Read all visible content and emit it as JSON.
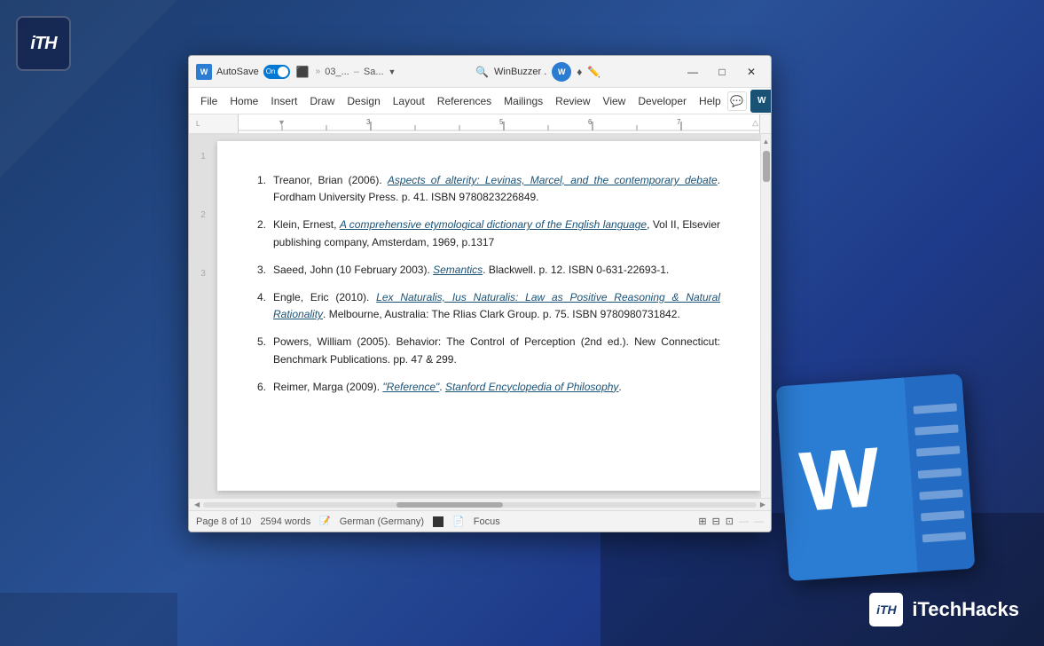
{
  "background": {
    "colors": {
      "primary": "#1a3a6b",
      "secondary": "#2a5298"
    }
  },
  "logo": {
    "letters": "iTH",
    "brand_name": "iTechHacks"
  },
  "titlebar": {
    "autosave_label": "AutoSave",
    "toggle_state": "On",
    "filename": "03_...",
    "separator": "–",
    "docname": "Sa...",
    "app_name": "WinBuzzer .",
    "search_placeholder": "Search"
  },
  "menubar": {
    "items": [
      "File",
      "Home",
      "Insert",
      "Draw",
      "Design",
      "Layout",
      "References",
      "Mailings",
      "Review",
      "View",
      "Developer",
      "Help"
    ]
  },
  "window_controls": {
    "minimize": "—",
    "maximize": "□",
    "close": "✕"
  },
  "references": [
    {
      "num": "1.",
      "text_before": "Treanor, Brian (2006).",
      "link_text": "Aspects of alterity: Levinas, Marcel, and the contemporary debate",
      "text_after": ". Fordham University Press. p. 41. ISBN 9780823226849."
    },
    {
      "num": "2.",
      "text_before": "Klein, Ernest,",
      "link_text": "A comprehensive etymological dictionary of the English language",
      "text_after": ", Vol II, Elsevier publishing company, Amsterdam, 1969, p.1317"
    },
    {
      "num": "3.",
      "text_before": "Saeed, John (10 February 2003).",
      "link_text": "Semantics",
      "text_after": ". Blackwell. p. 12. ISBN 0-631-22693-1."
    },
    {
      "num": "4.",
      "text_before": "Engle, Eric (2010).",
      "link_text": "Lex Naturalis, Ius Naturalis: Law as Positive Reasoning & Natural Rationality",
      "text_after": ". Melbourne, Australia: The Rlias Clark Group. p. 75. ISBN 9780980731842."
    },
    {
      "num": "5.",
      "text_before": "Powers, William (2005). Behavior: The Control of Perception (2nd ed.). New Connecticut: Benchmark Publications. pp. 47 & 299."
    },
    {
      "num": "6.",
      "text_before": "Reimer, Marga (2009).",
      "link_text": "\"Reference\"",
      "text_after": ".",
      "link2_text": "Stanford Encyclopedia of Philosophy",
      "text_after2": "."
    }
  ],
  "statusbar": {
    "page_info": "Page 8 of 10",
    "word_count": "2594 words",
    "language": "German (Germany)",
    "focus": "Focus"
  },
  "left_margin_numbers": [
    "1",
    "2",
    "3"
  ],
  "word_icon": {
    "letter": "W"
  }
}
